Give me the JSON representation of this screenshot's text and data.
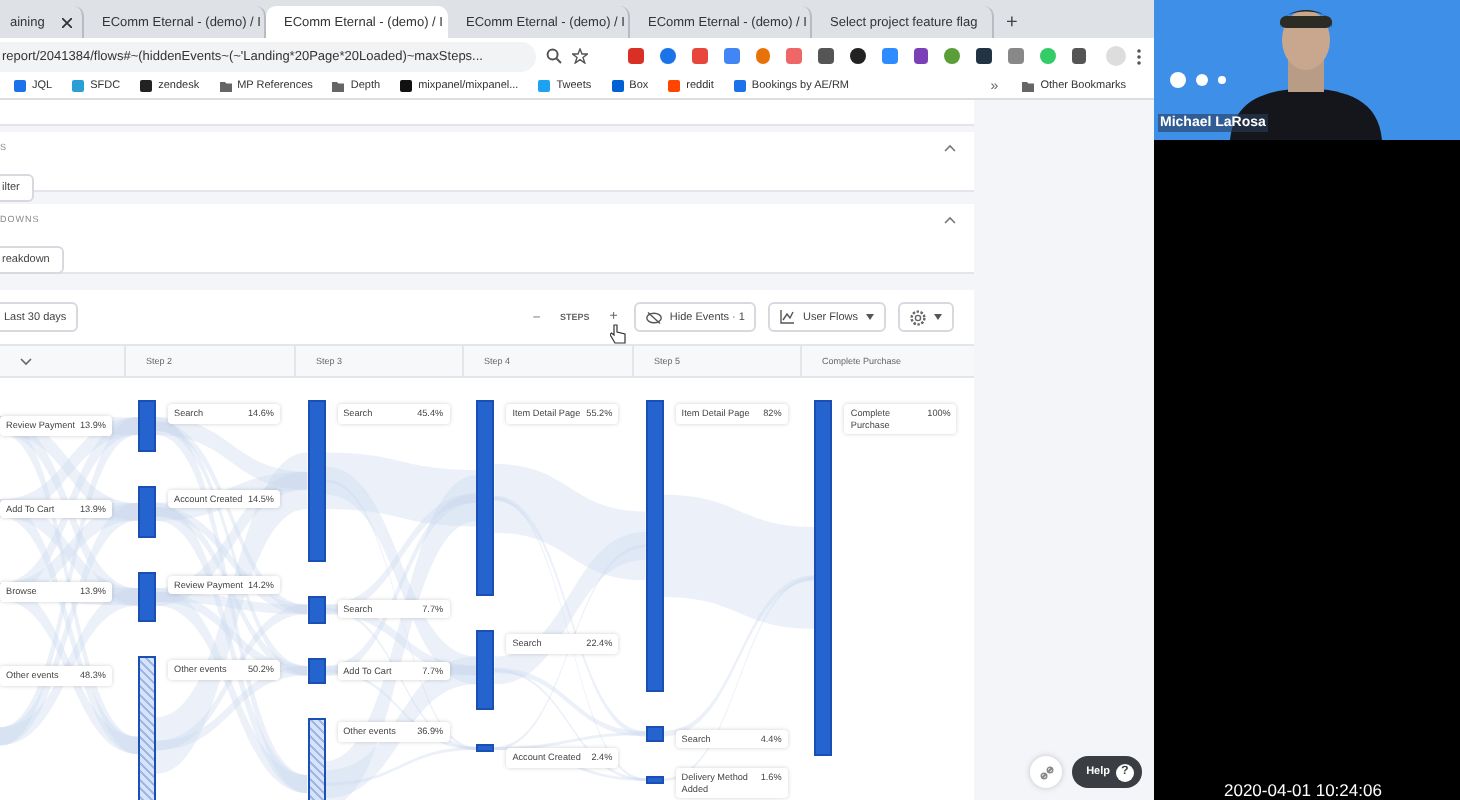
{
  "browser": {
    "tabs": [
      {
        "title": "aining",
        "selected": false
      },
      {
        "title": "EComm Eternal - (demo) / I",
        "selected": false
      },
      {
        "title": "EComm Eternal - (demo) / I",
        "selected": true
      },
      {
        "title": "EComm Eternal - (demo) / I",
        "selected": false
      },
      {
        "title": "EComm Eternal - (demo) / I",
        "selected": false
      },
      {
        "title": "Select project feature flag",
        "selected": false
      }
    ],
    "new_tab": "+",
    "address": "report/2041384/flows#~(hiddenEvents~(~'Landing*20Page*20Loaded)~maxSteps...",
    "bookmarks": [
      {
        "label": "JQL"
      },
      {
        "label": "SFDC"
      },
      {
        "label": "zendesk"
      },
      {
        "label": "MP References"
      },
      {
        "label": "Depth"
      },
      {
        "label": "mixpanel/mixpanel..."
      },
      {
        "label": "Tweets"
      },
      {
        "label": "Box"
      },
      {
        "label": "reddit"
      },
      {
        "label": "Bookings by AE/RM"
      }
    ],
    "overflow": "»",
    "other_bookmarks": "Other Bookmarks"
  },
  "sections": [
    {
      "title": "S",
      "button": "ilter",
      "expanded": true
    },
    {
      "title": "DOWNS",
      "button": "reakdown",
      "expanded": true
    }
  ],
  "flows": {
    "date_range": "Last 30 days",
    "steps_minus": "–",
    "steps_label": "STEPS",
    "steps_plus": "+",
    "hide_events": "Hide Events · 1",
    "view": "User Flows",
    "columns": [
      {
        "nodes": [
          {
            "label": "Review Payment",
            "percent": "13.9%",
            "kind": "event"
          },
          {
            "label": "Add To Cart",
            "percent": "13.9%",
            "kind": "event"
          },
          {
            "label": "Browse",
            "percent": "13.9%",
            "kind": "event"
          },
          {
            "label": "Other events",
            "percent": "48.3%",
            "kind": "other"
          }
        ]
      },
      {
        "header": "Step 2",
        "nodes": [
          {
            "label": "Search",
            "percent": "14.6%",
            "kind": "event"
          },
          {
            "label": "Account Created",
            "percent": "14.5%",
            "kind": "event"
          },
          {
            "label": "Review Payment",
            "percent": "14.2%",
            "kind": "event"
          },
          {
            "label": "Other events",
            "percent": "50.2%",
            "kind": "other"
          }
        ]
      },
      {
        "header": "Step 3",
        "nodes": [
          {
            "label": "Search",
            "percent": "45.4%",
            "kind": "event"
          },
          {
            "label": "Search",
            "percent": "7.7%",
            "kind": "event"
          },
          {
            "label": "Add To Cart",
            "percent": "7.7%",
            "kind": "event"
          },
          {
            "label": "Other events",
            "percent": "36.9%",
            "kind": "other"
          }
        ]
      },
      {
        "header": "Step 4",
        "nodes": [
          {
            "label": "Item Detail Page",
            "percent": "55.2%",
            "kind": "event"
          },
          {
            "label": "Search",
            "percent": "22.4%",
            "kind": "event"
          },
          {
            "label": "Account Created",
            "percent": "2.4%",
            "kind": "event"
          }
        ]
      },
      {
        "header": "Step 5",
        "nodes": [
          {
            "label": "Item Detail Page",
            "percent": "82%",
            "kind": "event"
          },
          {
            "label": "Search",
            "percent": "4.4%",
            "kind": "event"
          },
          {
            "label": "Delivery Method Added",
            "percent": "1.6%",
            "kind": "event"
          }
        ]
      },
      {
        "header": "Complete Purchase",
        "nodes": [
          {
            "label": "Complete Purchase",
            "percent": "100%",
            "kind": "event"
          }
        ]
      }
    ]
  },
  "help": {
    "label": "Help",
    "glyph": "?"
  },
  "call": {
    "participant": "Michael LaRosa",
    "timestamp": "2020-04-01 10:24:06"
  }
}
